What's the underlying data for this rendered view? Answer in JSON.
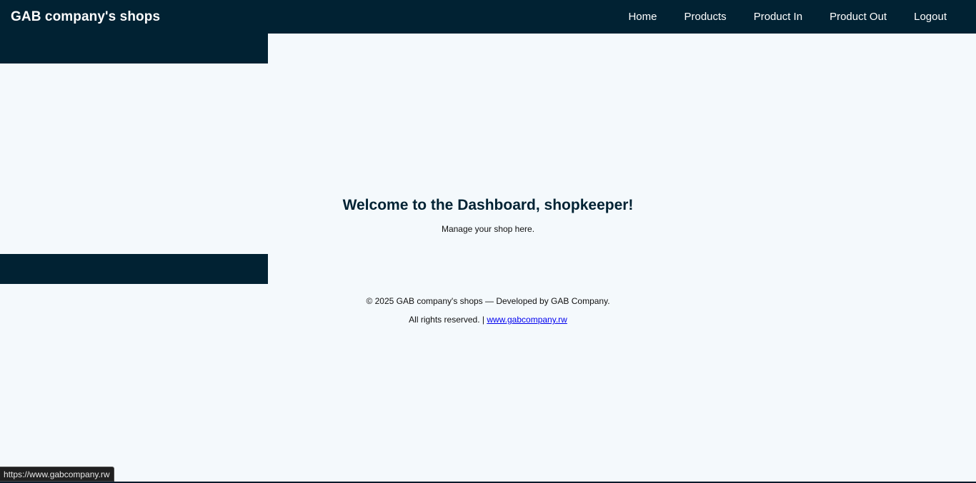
{
  "header": {
    "brand": "GAB company's shops",
    "nav": [
      "Home",
      "Products",
      "Product In",
      "Product Out",
      "Logout"
    ]
  },
  "main": {
    "title": "Welcome to the Dashboard, shopkeeper!",
    "subtitle": "Manage your shop here."
  },
  "footer": {
    "line1": "© 2025 GAB company's shops — Developed by GAB Company.",
    "line2_prefix": "All rights reserved. | ",
    "link_text": "www.gabcompany.rw"
  },
  "status_bar": {
    "url": "https://www.gabcompany.rw"
  },
  "colors": {
    "navy": "#012233",
    "background": "#f4f9fc",
    "link": "#0000ee"
  }
}
